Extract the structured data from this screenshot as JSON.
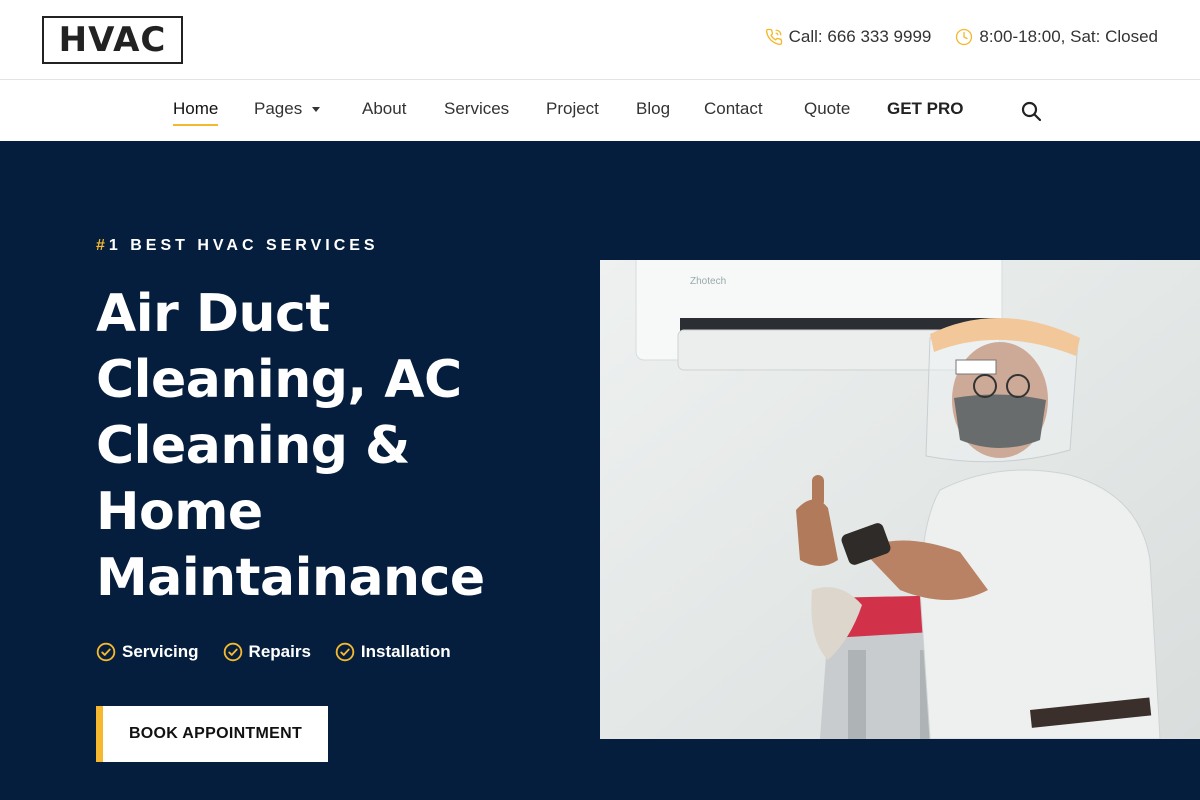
{
  "brand": {
    "logo_text": "HVAC"
  },
  "contact": {
    "phone": "Call: 666 333 9999",
    "hours": "8:00-18:00, Sat: Closed"
  },
  "nav": {
    "items": [
      {
        "label": "Home",
        "active": true
      },
      {
        "label": "Pages",
        "has_dropdown": true
      },
      {
        "label": "About"
      },
      {
        "label": "Services"
      },
      {
        "label": "Project"
      },
      {
        "label": "Blog"
      },
      {
        "label": "Contact"
      },
      {
        "label": "Quote"
      },
      {
        "label": "GET PRO"
      }
    ]
  },
  "hero": {
    "eyebrow_hash": "#",
    "eyebrow_rest": "1 BEST HVAC SERVICES",
    "headline_lines": [
      "Air Duct",
      "Cleaning, AC",
      "Cleaning &",
      "Home",
      "Maintainance"
    ],
    "features": [
      "Servicing",
      "Repairs",
      "Installation"
    ],
    "cta_label": "BOOK APPOINTMENT"
  },
  "colors": {
    "navy": "#051e3d",
    "accent": "#f5b82e",
    "white": "#ffffff"
  },
  "icons": {
    "phone": "phone-icon",
    "clock": "clock-icon",
    "search": "search-icon",
    "check": "check-circle-icon"
  }
}
